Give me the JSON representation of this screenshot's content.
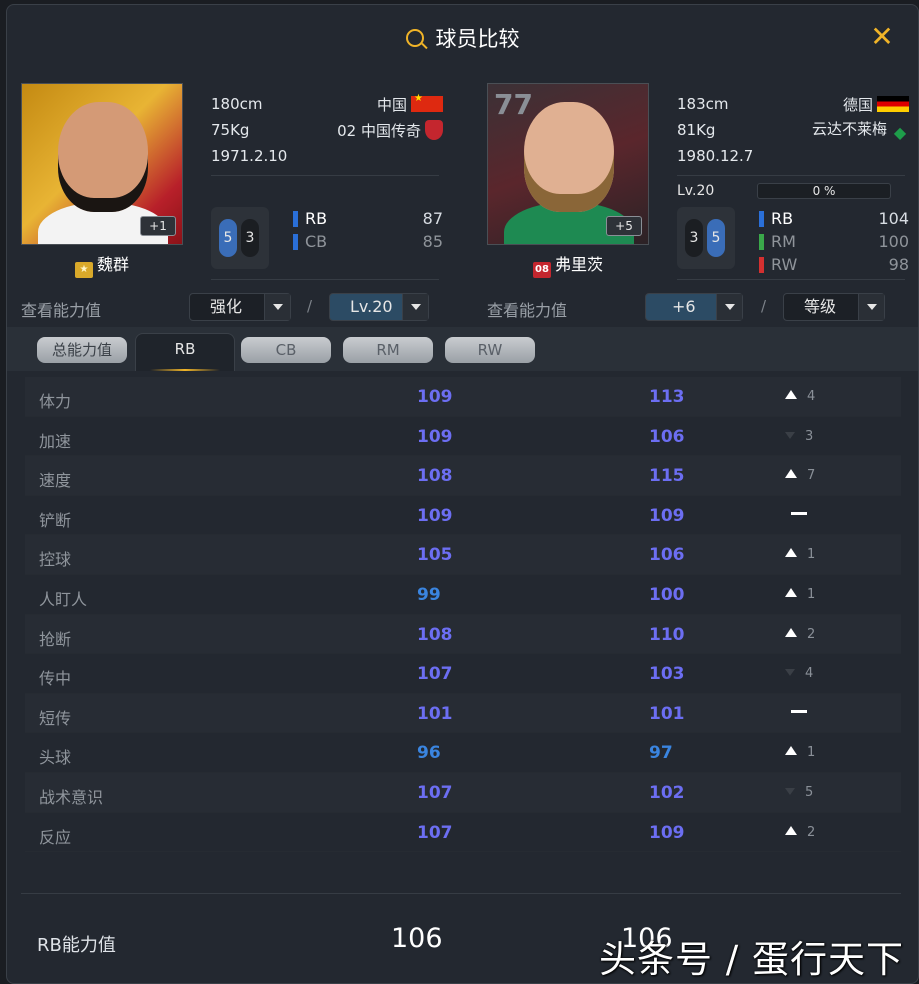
{
  "title": "球员比较",
  "player1": {
    "name": "魏群",
    "season_badge": "★",
    "height": "180cm",
    "weight": "75Kg",
    "birth": "1971.2.10",
    "nation": "中国",
    "club": "02 中国传奇",
    "enhance_badge": "+1",
    "foot_left": "5",
    "foot_right": "3",
    "positions": [
      {
        "pos": "RB",
        "value": "87",
        "color": "#2a6fd8"
      },
      {
        "pos": "CB",
        "value": "85",
        "color": "#2a6fd8"
      }
    ],
    "ability_label": "查看能力值",
    "dropdown1": "强化",
    "dropdown2": "Lv.20"
  },
  "player2": {
    "name": "弗里茨",
    "season_badge": "08",
    "overall": "77",
    "height": "183cm",
    "weight": "81Kg",
    "birth": "1980.12.7",
    "nation": "德国",
    "club": "云达不莱梅",
    "enhance_badge": "+5",
    "level": "Lv.20",
    "progress": "0 %",
    "foot_left": "3",
    "foot_right": "5",
    "positions": [
      {
        "pos": "RB",
        "value": "104",
        "color": "#2a6fd8"
      },
      {
        "pos": "RM",
        "value": "100",
        "color": "#3aa84a"
      },
      {
        "pos": "RW",
        "value": "98",
        "color": "#d43030"
      }
    ],
    "ability_label": "查看能力值",
    "dropdown1": "+6",
    "dropdown2": "等级"
  },
  "tabs": [
    "总能力值",
    "RB",
    "CB",
    "RM",
    "RW"
  ],
  "active_tab": "RB",
  "stats": [
    {
      "name": "体力",
      "v1": "109",
      "v2": "113",
      "trend": "up",
      "diff": "4"
    },
    {
      "name": "加速",
      "v1": "109",
      "v2": "106",
      "trend": "down",
      "diff": "3"
    },
    {
      "name": "速度",
      "v1": "108",
      "v2": "115",
      "trend": "up",
      "diff": "7"
    },
    {
      "name": "铲断",
      "v1": "109",
      "v2": "109",
      "trend": "same",
      "diff": ""
    },
    {
      "name": "控球",
      "v1": "105",
      "v2": "106",
      "trend": "up",
      "diff": "1"
    },
    {
      "name": "人盯人",
      "v1": "99",
      "v2": "100",
      "trend": "up",
      "diff": "1"
    },
    {
      "name": "抢断",
      "v1": "108",
      "v2": "110",
      "trend": "up",
      "diff": "2"
    },
    {
      "name": "传中",
      "v1": "107",
      "v2": "103",
      "trend": "down",
      "diff": "4"
    },
    {
      "name": "短传",
      "v1": "101",
      "v2": "101",
      "trend": "same",
      "diff": ""
    },
    {
      "name": "头球",
      "v1": "96",
      "v2": "97",
      "trend": "up",
      "diff": "1"
    },
    {
      "name": "战术意识",
      "v1": "107",
      "v2": "102",
      "trend": "down",
      "diff": "5"
    },
    {
      "name": "反应",
      "v1": "107",
      "v2": "109",
      "trend": "up",
      "diff": "2"
    }
  ],
  "footer": {
    "label": "RB能力值",
    "v1": "106",
    "v2": "106"
  },
  "watermark": "头条号 / 蛋行天下",
  "colors": {
    "accent": "#f0b428",
    "stat_value": "#6c6ef2",
    "stat_value_lower": "#3a85e0",
    "background": "#232830"
  }
}
